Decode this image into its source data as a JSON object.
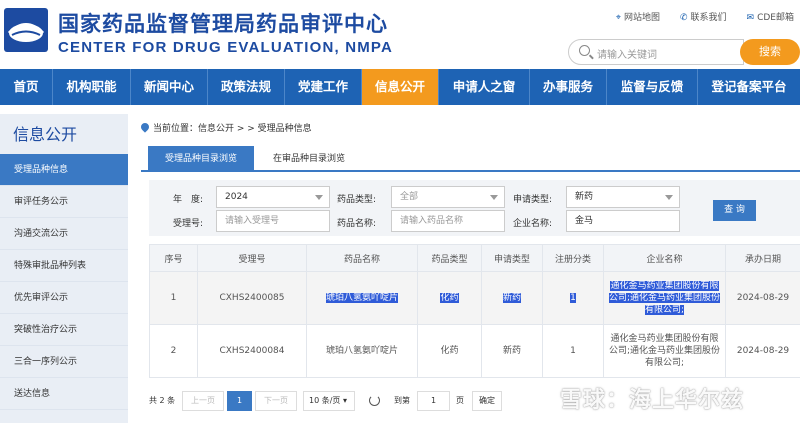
{
  "header": {
    "title_cn": "国家药品监督管理局药品审评中心",
    "title_en": "CENTER FOR DRUG EVALUATION, NMPA",
    "links": [
      {
        "icon": "location-pin-icon",
        "label": "网站地图"
      },
      {
        "icon": "phone-icon",
        "label": "联系我们"
      },
      {
        "icon": "mail-icon",
        "label": "CDE邮箱"
      }
    ],
    "search_placeholder": "请输入关键词",
    "search_button": "搜索"
  },
  "nav": [
    "首页",
    "机构职能",
    "新闻中心",
    "政策法规",
    "党建工作",
    "信息公开",
    "申请人之窗",
    "办事服务",
    "监督与反馈",
    "登记备案平台"
  ],
  "sidebar": {
    "title": "信息公开",
    "items": [
      "受理品种信息",
      "审评任务公示",
      "沟通交流公示",
      "特殊审批品种列表",
      "优先审评公示",
      "突破性治疗公示",
      "三合一序列公示",
      "送达信息"
    ]
  },
  "breadcrumb": "当前位置：信息公开 > > 受理品种信息",
  "tabs": [
    "受理品种目录浏览",
    "在审品种目录浏览"
  ],
  "filters": {
    "year_label": "年　度:",
    "year_value": "2024",
    "drug_type_label": "药品类型:",
    "drug_type_value": "全部",
    "apply_type_label": "申请类型:",
    "apply_type_value": "新药",
    "accept_no_label": "受理号:",
    "accept_no_placeholder": "请输入受理号",
    "drug_name_label": "药品名称:",
    "drug_name_placeholder": "请输入药品名称",
    "company_label": "企业名称:",
    "company_value": "金马",
    "query_button": "查 询"
  },
  "table": {
    "headers": [
      "序号",
      "受理号",
      "药品名称",
      "药品类型",
      "申请类型",
      "注册分类",
      "企业名称",
      "承办日期"
    ],
    "rows": [
      {
        "no": "1",
        "accept_no": "CXHS2400085",
        "drug_name": "琥珀八氢氨吖啶片",
        "drug_type": "化药",
        "apply_type": "新药",
        "category": "1",
        "company": "通化金马药业集团股份有限公司;通化金马药业集团股份有限公司;",
        "date": "2024-08-29"
      },
      {
        "no": "2",
        "accept_no": "CXHS2400084",
        "drug_name": "琥珀八氢氨吖啶片",
        "drug_type": "化药",
        "apply_type": "新药",
        "category": "1",
        "company": "通化金马药业集团股份有限公司;通化金马药业集团股份有限公司;",
        "date": "2024-08-29"
      }
    ]
  },
  "pager": {
    "total": "共 2 条",
    "prev": "上一页",
    "current": "1",
    "next": "下一页",
    "page_size": "10 条/页",
    "goto_label": "到第",
    "goto_value": "1",
    "page_unit": "页",
    "confirm": "确定"
  },
  "watermark": "雪球：海上华尔兹",
  "colors": {
    "brand_blue": "#1e63b4",
    "accent_orange": "#f39a1e",
    "highlight": "#2f5bd8"
  }
}
